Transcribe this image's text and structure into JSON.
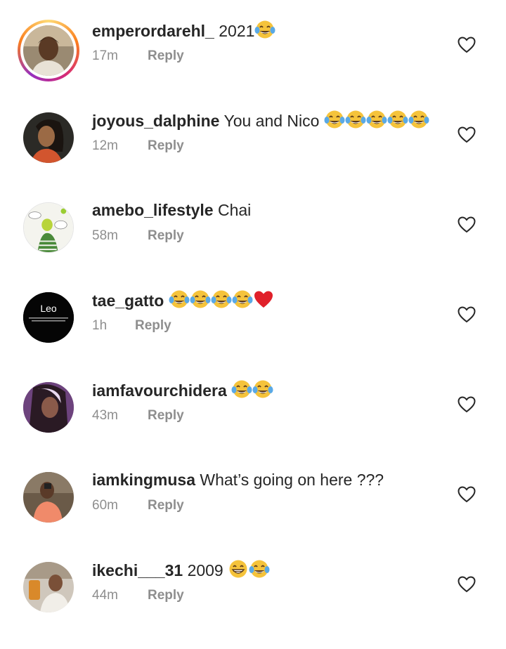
{
  "comments": [
    {
      "username": "emperordarehl_",
      "text": "2021",
      "emojis": [
        "joy"
      ],
      "time": "17m",
      "reply": "Reply",
      "story": true
    },
    {
      "username": "joyous_dalphine",
      "text": "You and Nico",
      "emojis": [
        "joy",
        "joy",
        "joy",
        "joy",
        "joy"
      ],
      "time": "12m",
      "reply": "Reply",
      "story": false
    },
    {
      "username": "amebo_lifestyle",
      "text": "Chai",
      "emojis": [],
      "time": "58m",
      "reply": "Reply",
      "story": false
    },
    {
      "username": "tae_gatto",
      "text": "",
      "emojis": [
        "joy",
        "joy",
        "joy",
        "joy",
        "heart"
      ],
      "time": "1h",
      "reply": "Reply",
      "story": false,
      "avatar_text": "Leo"
    },
    {
      "username": "iamfavourchidera",
      "text": "",
      "emojis": [
        "joy",
        "joy"
      ],
      "time": "43m",
      "reply": "Reply",
      "story": false
    },
    {
      "username": "iamkingmusa",
      "text": "What’s going on here ???",
      "emojis": [],
      "time": "60m",
      "reply": "Reply",
      "story": false
    },
    {
      "username": "ikechi___31",
      "text": "2009",
      "emojis": [
        "grin",
        "joy"
      ],
      "time": "44m",
      "reply": "Reply",
      "story": false
    }
  ],
  "icons": {
    "like": "heart-outline-icon"
  },
  "colors": {
    "username": "#262626",
    "meta": "#8e8e8e",
    "story_ring": [
      "#feda75",
      "#fa7e1e",
      "#d62976",
      "#962fbf"
    ]
  }
}
